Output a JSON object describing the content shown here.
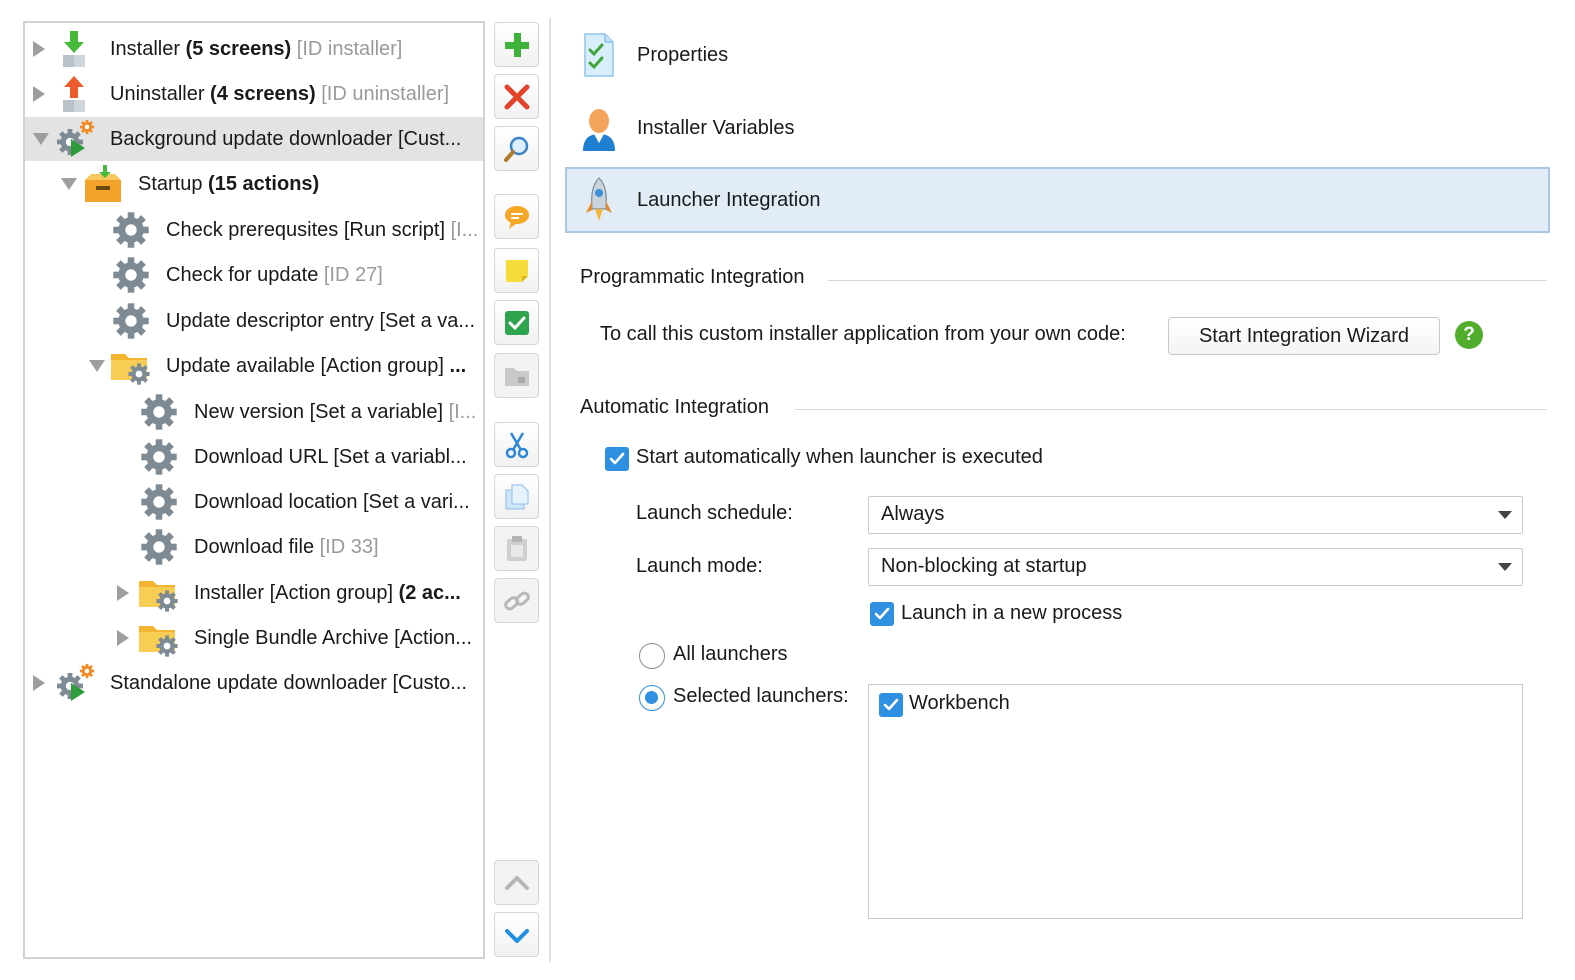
{
  "tree": {
    "rows": [
      {
        "parts": [
          {
            "t": "Installer ",
            "s": ""
          },
          {
            "t": "(5 screens)",
            "s": "b"
          },
          {
            "t": " [ID installer]",
            "s": "g"
          }
        ],
        "icon": "installer-arrow-down-icon"
      },
      {
        "parts": [
          {
            "t": "Uninstaller ",
            "s": ""
          },
          {
            "t": "(4 screens)",
            "s": "b"
          },
          {
            "t": " [ID uninstaller]",
            "s": "g"
          }
        ],
        "icon": "uninstaller-arrow-up-icon"
      },
      {
        "parts": [
          {
            "t": "Background update downloader [Cust...",
            "s": ""
          }
        ],
        "icon": "custom-application-gear-icon"
      },
      {
        "parts": [
          {
            "t": "Startup ",
            "s": ""
          },
          {
            "t": "(15 actions)",
            "s": "b"
          }
        ],
        "icon": "startup-box-icon"
      },
      {
        "parts": [
          {
            "t": "Check prerequsites [Run script] ",
            "s": ""
          },
          {
            "t": "[I...",
            "s": "g"
          }
        ],
        "icon": "action-gear-icon"
      },
      {
        "parts": [
          {
            "t": "Check for update ",
            "s": ""
          },
          {
            "t": "[ID 27]",
            "s": "g"
          }
        ],
        "icon": "action-gear-icon"
      },
      {
        "parts": [
          {
            "t": "Update descriptor entry [Set a va...",
            "s": ""
          }
        ],
        "icon": "action-gear-icon"
      },
      {
        "parts": [
          {
            "t": "Update available [Action group] ",
            "s": ""
          },
          {
            "t": "...",
            "s": "b"
          }
        ],
        "icon": "action-group-folder-icon"
      },
      {
        "parts": [
          {
            "t": "New version [Set a variable] ",
            "s": ""
          },
          {
            "t": "[I...",
            "s": "g"
          }
        ],
        "icon": "action-gear-icon"
      },
      {
        "parts": [
          {
            "t": "Download URL [Set a variabl...",
            "s": ""
          }
        ],
        "icon": "action-gear-icon"
      },
      {
        "parts": [
          {
            "t": "Download location [Set a vari...",
            "s": ""
          }
        ],
        "icon": "action-gear-icon"
      },
      {
        "parts": [
          {
            "t": "Download file ",
            "s": ""
          },
          {
            "t": "[ID 33]",
            "s": "g"
          }
        ],
        "icon": "action-gear-icon"
      },
      {
        "parts": [
          {
            "t": "Installer [Action group] ",
            "s": ""
          },
          {
            "t": "(2 ac...",
            "s": "b"
          }
        ],
        "icon": "action-group-folder-icon"
      },
      {
        "parts": [
          {
            "t": "Single Bundle Archive [Action...",
            "s": ""
          }
        ],
        "icon": "action-group-folder-icon"
      },
      {
        "parts": [
          {
            "t": "Standalone update downloader [Custo...",
            "s": ""
          }
        ],
        "icon": "custom-application-gear-icon"
      }
    ]
  },
  "toolbar": {
    "buttons": [
      {
        "name": "add-button",
        "icon": "plus-icon"
      },
      {
        "name": "delete-button",
        "icon": "x-icon"
      },
      {
        "name": "search-button",
        "icon": "magnifier-icon"
      },
      {
        "name": "comment-button",
        "icon": "speech-bubble-icon"
      },
      {
        "name": "note-button",
        "icon": "sticky-note-icon"
      },
      {
        "name": "check-button",
        "icon": "checkmark-icon"
      },
      {
        "name": "group-button",
        "icon": "folder-icon"
      },
      {
        "name": "cut-button",
        "icon": "scissors-icon"
      },
      {
        "name": "copy-button",
        "icon": "copy-icon"
      },
      {
        "name": "paste-button",
        "icon": "clipboard-icon"
      },
      {
        "name": "link-button",
        "icon": "link-icon"
      },
      {
        "name": "move-up-button",
        "icon": "chevron-up-icon"
      },
      {
        "name": "move-down-button",
        "icon": "chevron-down-icon"
      }
    ]
  },
  "nav": {
    "properties": "Properties",
    "installer_variables": "Installer Variables",
    "launcher_integration": "Launcher Integration"
  },
  "programmatic": {
    "title": "Programmatic Integration",
    "description": "To call this custom installer application from your own code:",
    "wizard_button": "Start Integration Wizard",
    "help": "?"
  },
  "automatic": {
    "title": "Automatic Integration",
    "start_auto_label": "Start automatically when launcher is executed",
    "start_auto_checked": true,
    "schedule_label": "Launch schedule:",
    "schedule_value": "Always",
    "mode_label": "Launch mode:",
    "mode_value": "Non-blocking at startup",
    "new_process_label": "Launch in a new process",
    "new_process_checked": true,
    "all_launchers_label": "All launchers",
    "selected_launchers_label": "Selected launchers:",
    "selected_option": "selected",
    "launchers": [
      {
        "label": "Workbench",
        "checked": true
      }
    ]
  },
  "colors": {
    "accent": "#2f8fe0",
    "selection_bg": "#e1ecf6",
    "selection_border": "#a9c8e6",
    "help_green": "#52ad2c"
  }
}
